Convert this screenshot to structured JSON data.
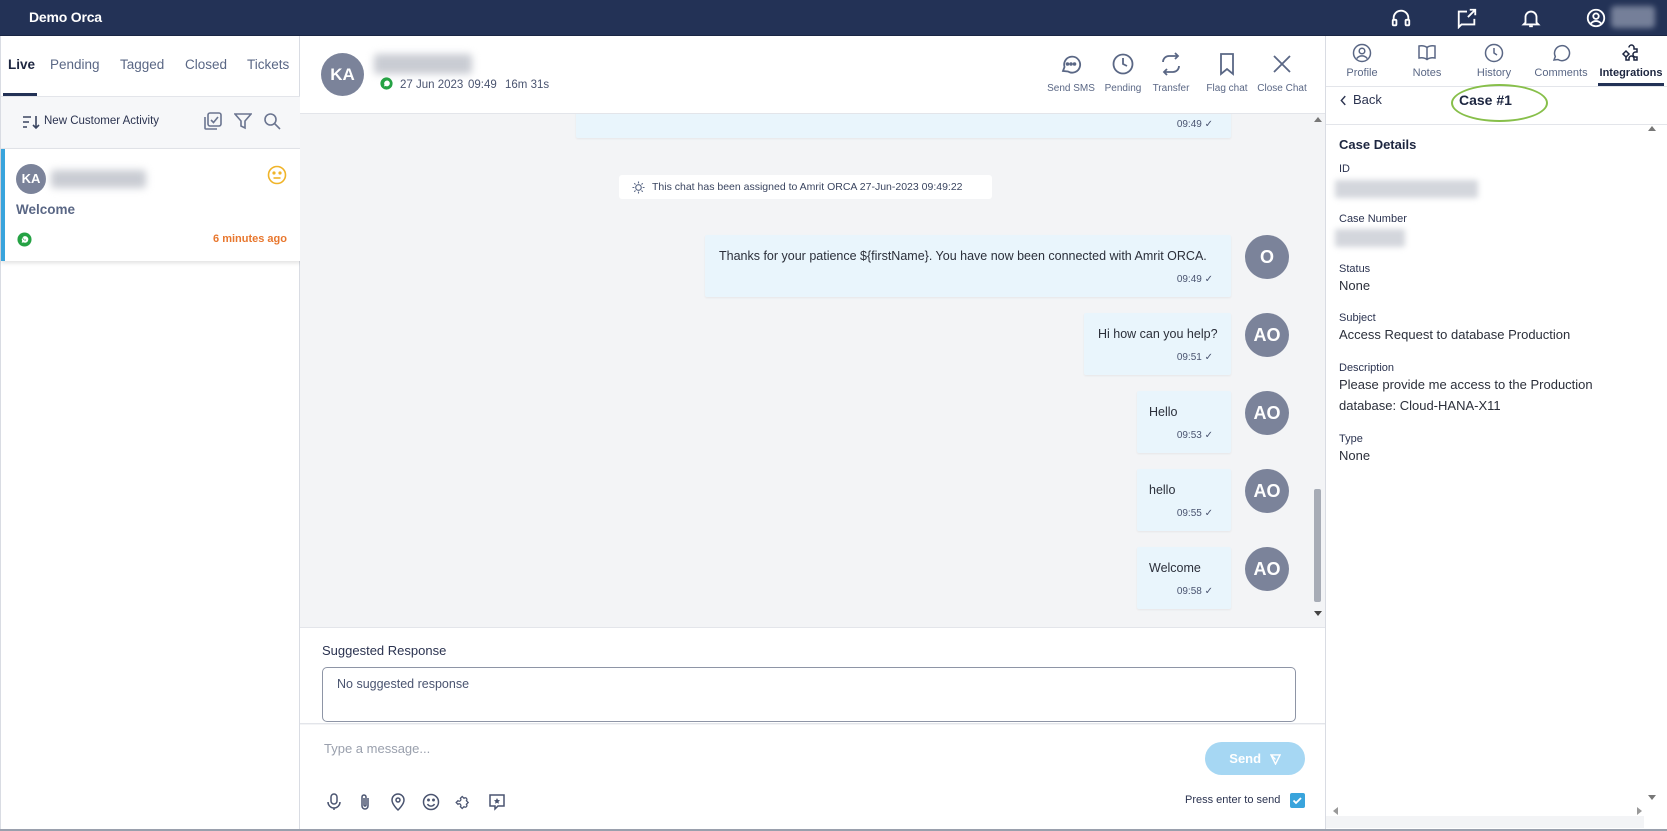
{
  "app": {
    "brand": "Demo Orca"
  },
  "colors": {
    "topbar": "#233256",
    "accent": "#39a4dc",
    "bubble": "#e9f5fc",
    "highlight_ring": "#87bf4a",
    "time_orange": "#e8772e"
  },
  "left": {
    "tabs": [
      "Live",
      "Pending",
      "Tagged",
      "Closed",
      "Tickets"
    ],
    "active_tab": "Live",
    "sort_label": "New Customer Activity",
    "chat_card": {
      "initials": "KA",
      "message": "Welcome",
      "time": "6 minutes ago"
    }
  },
  "chat": {
    "initials": "KA",
    "date": "27 Jun 2023",
    "time": "09:49",
    "duration": "16m 31s",
    "actions": [
      "Send SMS",
      "Pending",
      "Transfer",
      "Flag chat",
      "Close Chat"
    ],
    "top_bubble_time": "09:49 ✓",
    "system_note": "This chat has been assigned to Amrit ORCA 27-Jun-2023 09:49:22",
    "messages": [
      {
        "avatar": "O",
        "text": "Thanks for your patience ${firstName}. You have now been connected with Amrit ORCA.",
        "time": "09:49 ✓"
      },
      {
        "avatar": "AO",
        "text": "Hi how can you help?",
        "time": "09:51 ✓"
      },
      {
        "avatar": "AO",
        "text": "Hello",
        "time": "09:53 ✓"
      },
      {
        "avatar": "AO",
        "text": "hello",
        "time": "09:55 ✓"
      },
      {
        "avatar": "AO",
        "text": "Welcome",
        "time": "09:58 ✓"
      }
    ],
    "suggested_title": "Suggested Response",
    "suggested_text": "No suggested response",
    "input_placeholder": "Type a message...",
    "send_label": "Send",
    "enter_to_send": "Press enter to send"
  },
  "right": {
    "tabs": [
      "Profile",
      "Notes",
      "History",
      "Comments",
      "Integrations"
    ],
    "active_tab": "Integrations",
    "back_label": "Back",
    "case_title": "Case #1",
    "details_title": "Case Details",
    "fields": {
      "id_label": "ID",
      "case_number_label": "Case Number",
      "status_label": "Status",
      "status_value": "None",
      "subject_label": "Subject",
      "subject_value": "Access Request to database Production",
      "description_label": "Description",
      "description_value_line1": "Please provide me access to the Production",
      "description_value_line2": "database: Cloud-HANA-X11",
      "type_label": "Type",
      "type_value": "None"
    }
  }
}
